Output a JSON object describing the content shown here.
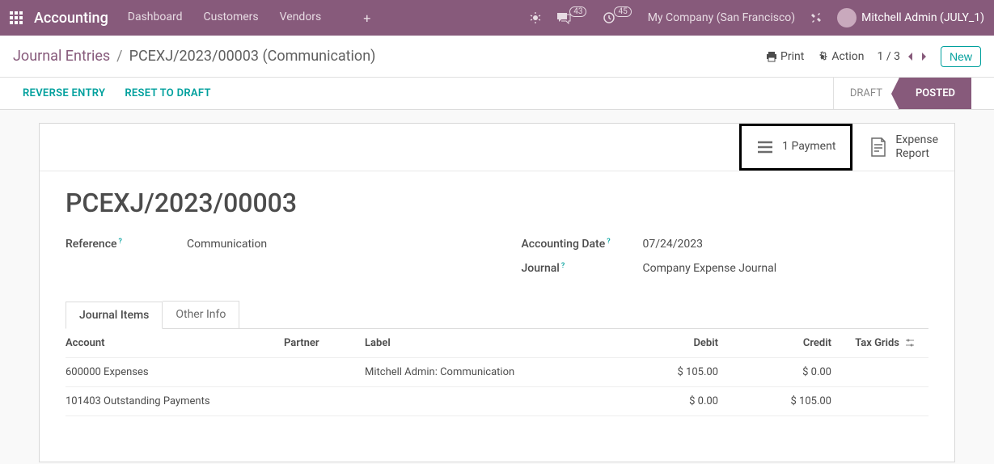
{
  "topbar": {
    "brand": "Accounting",
    "menu": [
      "Dashboard",
      "Customers",
      "Vendors"
    ],
    "msg_count": "43",
    "activity_count": "45",
    "company": "My Company (San Francisco)",
    "user": "Mitchell Admin (JULY_1)"
  },
  "controlbar": {
    "bc_root": "Journal Entries",
    "bc_current": "PCEXJ/2023/00003 (Communication)",
    "print": "Print",
    "action": "Action",
    "pager": "1 / 3",
    "new": "New"
  },
  "statusbar": {
    "reverse": "REVERSE ENTRY",
    "reset": "RESET TO DRAFT",
    "draft": "DRAFT",
    "posted": "POSTED"
  },
  "statboxes": {
    "payment": "1 Payment",
    "expense1": "Expense",
    "expense2": "Report"
  },
  "entry": {
    "title": "PCEXJ/2023/00003",
    "ref_label": "Reference",
    "ref_value": "Communication",
    "date_label": "Accounting Date",
    "date_value": "07/24/2023",
    "journal_label": "Journal",
    "journal_value": "Company Expense Journal"
  },
  "tabs": {
    "items": "Journal Items",
    "other": "Other Info"
  },
  "grid": {
    "headers": {
      "account": "Account",
      "partner": "Partner",
      "label": "Label",
      "debit": "Debit",
      "credit": "Credit",
      "tax": "Tax Grids"
    },
    "rows": [
      {
        "account": "600000 Expenses",
        "partner": "",
        "label": "Mitchell Admin: Communication",
        "debit": "$ 105.00",
        "credit": "$ 0.00",
        "tax": ""
      },
      {
        "account": "101403 Outstanding Payments",
        "partner": "",
        "label": "",
        "debit": "$ 0.00",
        "credit": "$ 105.00",
        "tax": ""
      }
    ]
  }
}
